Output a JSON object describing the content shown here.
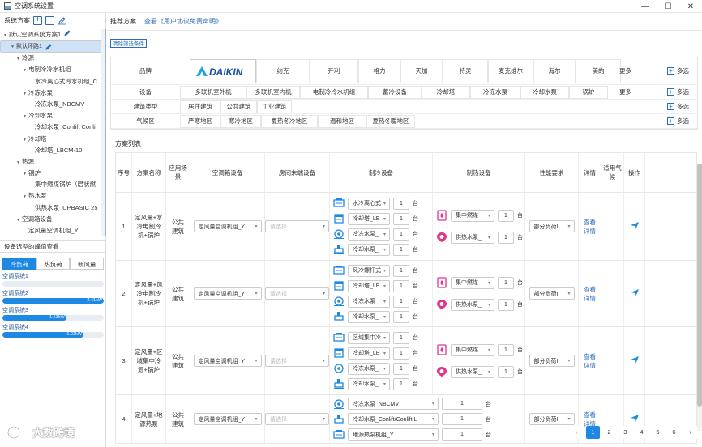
{
  "window": {
    "title": "空调系统设置",
    "controls": [
      "—",
      "☐",
      "✕"
    ]
  },
  "left": {
    "header": "系统方案",
    "tree": [
      {
        "label": "默认空调系统方案1",
        "level": 0,
        "caret": "▼",
        "edit": true
      },
      {
        "label": "默认环路1",
        "level": 1,
        "caret": "▼",
        "edit": true,
        "selected": true
      },
      {
        "label": "冷源",
        "level": 2,
        "caret": "▼"
      },
      {
        "label": "电制冷冷水机组",
        "level": 3,
        "caret": "▼"
      },
      {
        "label": "水冷离心式冷水机组_C",
        "level": 4,
        "caret": ""
      },
      {
        "label": "冷冻水泵",
        "level": 3,
        "caret": "▼"
      },
      {
        "label": "冷冻水泵_NBCMV",
        "level": 4,
        "caret": ""
      },
      {
        "label": "冷却水泵",
        "level": 3,
        "caret": "▼"
      },
      {
        "label": "冷却水泵_Conlift Conli",
        "level": 4,
        "caret": ""
      },
      {
        "label": "冷却塔",
        "level": 3,
        "caret": "▼"
      },
      {
        "label": "冷却塔_LBCM-10",
        "level": 4,
        "caret": ""
      },
      {
        "label": "热源",
        "level": 2,
        "caret": "▼"
      },
      {
        "label": "锅炉",
        "level": 3,
        "caret": "▼"
      },
      {
        "label": "集中燃煤锅炉（层状燃",
        "level": 4,
        "caret": ""
      },
      {
        "label": "热水泵",
        "level": 3,
        "caret": "▼"
      },
      {
        "label": "供热水泵_UPBASIC 25",
        "level": 4,
        "caret": ""
      },
      {
        "label": "空调箱设备",
        "level": 2,
        "caret": "▼"
      },
      {
        "label": "定风量空调机组_Y",
        "level": 3,
        "caret": ""
      }
    ],
    "peak": {
      "title": "设备选型的峰值查看",
      "tabs": [
        {
          "label": "冷负荷",
          "active": true
        },
        {
          "label": "热负荷",
          "active": false
        },
        {
          "label": "新风量",
          "active": false
        }
      ],
      "systems": [
        {
          "label": "空调系统1",
          "value": "",
          "fraction": 0
        },
        {
          "label": "空调系统2",
          "value": "2.41kW",
          "fraction": 1.0
        },
        {
          "label": "空调系统3",
          "value": "1.53kW",
          "fraction": 0.63
        },
        {
          "label": "空调系统4",
          "value": "1.93kW",
          "fraction": 0.8
        }
      ]
    }
  },
  "right": {
    "rec_title": "推荐方案",
    "rec_link": "查看《用户协议免责声明》",
    "clear_btn": "清除筛选条件",
    "more_label": "更多",
    "multi_label": "多选",
    "filters": [
      {
        "name": "品牌",
        "options": [
          "DAIKIN",
          "约克",
          "开利",
          "格力",
          "天加",
          "特灵",
          "麦克维尔",
          "海尔",
          "美的"
        ],
        "more": true
      },
      {
        "name": "设备",
        "options": [
          "多联机室外机",
          "多联机室内机",
          "电制冷冷水机组",
          "蓄冷设备",
          "冷却塔",
          "冷冻水泵",
          "冷却水泵",
          "锅炉"
        ],
        "more": true
      },
      {
        "name": "建筑类型",
        "options": [
          "居住建筑",
          "公共建筑",
          "工业建筑"
        ],
        "more": false
      },
      {
        "name": "气候区",
        "options": [
          "严寒地区",
          "寒冷地区",
          "夏热冬冷地区",
          "温和地区",
          "夏热冬暖地区"
        ],
        "more": false
      }
    ],
    "list_title": "方案列表",
    "columns": [
      "序号",
      "方案名称",
      "应用场景",
      "空调箱设备",
      "房间末端设备",
      "制冷设备",
      "制热设备",
      "性能要求",
      "详情",
      "适用气候",
      "操作"
    ],
    "rows": [
      {
        "no": "1",
        "name": "定风量+水冷电制冷机+锅炉",
        "scene": "公共建筑",
        "ahu": "定风量空调机组_Y",
        "terminal": "请选择",
        "cool": [
          {
            "icon": "chiller",
            "name": "水冷离心式",
            "qty": "1"
          },
          {
            "icon": "tower",
            "name": "冷却塔_LE",
            "qty": "1"
          },
          {
            "icon": "pump",
            "name": "冷冻水泵_",
            "qty": "1"
          },
          {
            "icon": "valve",
            "name": "冷却水泵_",
            "qty": "1"
          }
        ],
        "heat": [
          {
            "icon": "boiler",
            "name": "集中燃煤",
            "qty": "1"
          },
          {
            "icon": "hpump",
            "name": "供热水泵_",
            "qty": "1"
          }
        ],
        "perf": "部分负荷II",
        "detail": "查看详情"
      },
      {
        "no": "2",
        "name": "定风量+风冷电制冷机+锅炉",
        "scene": "公共建筑",
        "ahu": "定风量空调机组_Y",
        "terminal": "请选择",
        "cool": [
          {
            "icon": "chiller",
            "name": "风冷螺杆式",
            "qty": "1"
          },
          {
            "icon": "tower",
            "name": "冷却塔_LE",
            "qty": "1"
          },
          {
            "icon": "pump",
            "name": "冷冻水泵_",
            "qty": "1"
          },
          {
            "icon": "valve",
            "name": "冷却水泵_",
            "qty": "1"
          }
        ],
        "heat": [
          {
            "icon": "boiler",
            "name": "集中燃煤",
            "qty": "1"
          },
          {
            "icon": "hpump",
            "name": "供热水泵_",
            "qty": "1"
          }
        ],
        "perf": "部分负荷II",
        "detail": "查看详情"
      },
      {
        "no": "3",
        "name": "定风量+区域集中冷源+锅炉",
        "scene": "公共建筑",
        "ahu": "定风量空调机组_Y",
        "terminal": "请选择",
        "cool": [
          {
            "icon": "chiller",
            "name": "区域集中冷",
            "qty": "1"
          },
          {
            "icon": "tower",
            "name": "冷却塔_LE",
            "qty": "1"
          },
          {
            "icon": "pump",
            "name": "冷冻水泵_",
            "qty": "1"
          },
          {
            "icon": "valve",
            "name": "冷却水泵_",
            "qty": "1"
          }
        ],
        "heat": [
          {
            "icon": "boiler",
            "name": "集中燃煤",
            "qty": "1"
          },
          {
            "icon": "hpump",
            "name": "供热水泵_",
            "qty": "1"
          }
        ],
        "perf": "部分负荷II",
        "detail": "查看详情"
      },
      {
        "no": "4",
        "name": "定风量+地源热泵",
        "scene": "公共建筑",
        "ahu": "定风量空调机组_Y",
        "terminal": "请选择",
        "cool": [
          {
            "icon": "pump",
            "name": "冷冻水泵_NBCMV",
            "qty": "1"
          },
          {
            "icon": "valve",
            "name": "冷却水泵_Conlift/Conlift L",
            "qty": "1"
          },
          {
            "icon": "chiller",
            "name": "地源热泵机组_Y",
            "qty": "1"
          }
        ],
        "heat": [],
        "perf": "部分负荷II",
        "detail": "查看详情"
      }
    ],
    "pager": {
      "prev": "‹",
      "pages": [
        "1",
        "2",
        "3",
        "4",
        "5",
        "6"
      ],
      "active": "1",
      "next": "›"
    }
  },
  "watermark": "大数跨境",
  "colors": {
    "accent": "#1e88e5",
    "link": "#2b6cb8",
    "boiler": "#e0368a"
  }
}
